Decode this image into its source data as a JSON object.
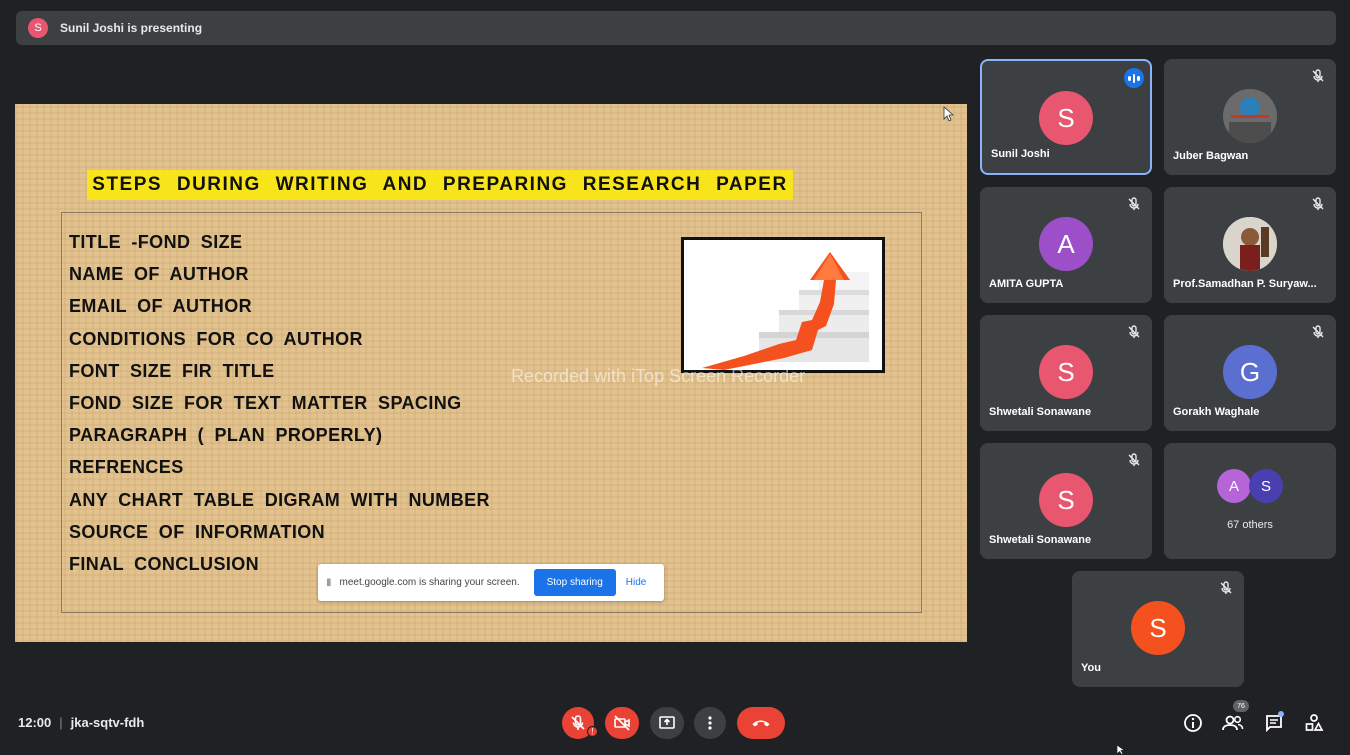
{
  "banner": {
    "avatar_letter": "S",
    "text": "Sunil Joshi is presenting"
  },
  "slide": {
    "title": "STEPS DURING WRITING AND PREPARING RESEARCH PAPER",
    "items": [
      "TITLE -FOND SIZE",
      "NAME OF AUTHOR",
      "EMAIL OF AUTHOR",
      "CONDITIONS FOR CO AUTHOR",
      "FONT SIZE FIR TITLE",
      "FOND SIZE FOR TEXT MATTER SPACING",
      "PARAGRAPH ( PLAN PROPERLY)",
      "REFRENCES",
      "ANY CHART TABLE DIGRAM WITH NUMBER",
      "SOURCE OF INFORMATION",
      "FINAL CONCLUSION"
    ],
    "watermark": "Recorded with iTop Screen Recorder"
  },
  "share_bar": {
    "text": "meet.google.com is sharing your screen.",
    "stop_label": "Stop sharing",
    "hide_label": "Hide"
  },
  "participants": [
    {
      "name": "Sunil Joshi",
      "letter": "S",
      "color": "#e8566f",
      "speaking": true
    },
    {
      "name": "Juber Bagwan",
      "letter": "",
      "color": "#5f6368",
      "muted": true
    },
    {
      "name": "AMITA GUPTA",
      "letter": "A",
      "color": "#9c4fc9",
      "muted": true
    },
    {
      "name": "Prof.Samadhan P. Suryaw...",
      "letter": "",
      "color": "#c8c2b8",
      "muted": true
    },
    {
      "name": "Shwetali Sonawane",
      "letter": "S",
      "color": "#e8566f",
      "muted": true
    },
    {
      "name": "Gorakh Waghale",
      "letter": "G",
      "color": "#5b6fd1",
      "muted": true
    },
    {
      "name": "Shwetali Sonawane",
      "letter": "S",
      "color": "#e8566f",
      "muted": true
    },
    {
      "name": "You",
      "letter": "S",
      "color": "#f4511e",
      "muted": true
    }
  ],
  "others": {
    "letters": [
      "A",
      "S"
    ],
    "colors": [
      "#b565d8",
      "#4a3fb0"
    ],
    "label": "67 others"
  },
  "meeting": {
    "time": "12:00",
    "code": "jka-sqtv-fdh"
  },
  "people_count": "76",
  "colors": {
    "background": "#202124",
    "tile": "#3c4043",
    "danger": "#ea4335",
    "accent": "#1a73e8"
  }
}
